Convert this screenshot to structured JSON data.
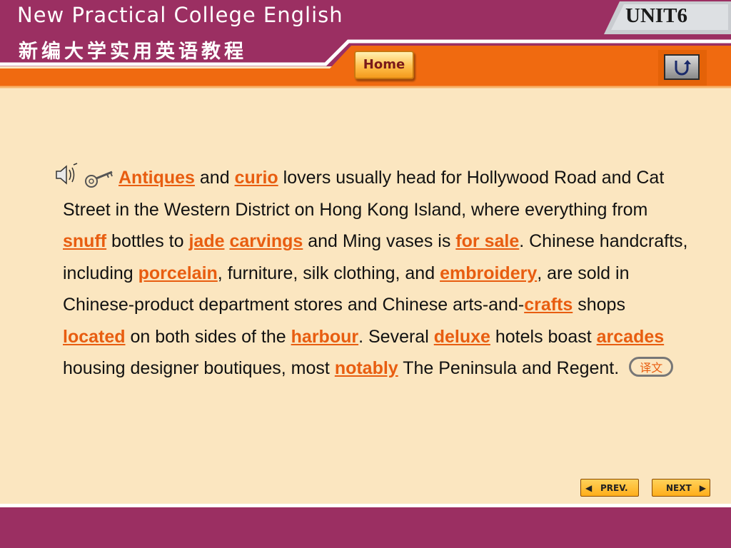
{
  "header": {
    "title_en": "New Practical College English",
    "title_cn": "新编大学实用英语教程",
    "unit_label": "UNIT6",
    "home_label": "Home"
  },
  "icons": {
    "speaker": "speaker-icon",
    "key": "key-icon",
    "return": "return-icon"
  },
  "passage": [
    {
      "t": "Antiques",
      "v": true
    },
    {
      "t": " and "
    },
    {
      "t": "curio",
      "v": true
    },
    {
      "t": " lovers usually head for Hollywood Road and Cat Street in the Western District on Hong Kong Island, where everything from "
    },
    {
      "t": "snuff",
      "v": true
    },
    {
      "t": " bottles to "
    },
    {
      "t": "jade",
      "v": true
    },
    {
      "t": " "
    },
    {
      "t": "carvings",
      "v": true
    },
    {
      "t": " and Ming vases is "
    },
    {
      "t": "for sale",
      "v": true
    },
    {
      "t": ". Chinese handcrafts, including "
    },
    {
      "t": "porcelain",
      "v": true
    },
    {
      "t": ", furniture, silk clothing, and "
    },
    {
      "t": "embroidery",
      "v": true
    },
    {
      "t": ", are sold in Chinese-product department stores and Chinese arts-and-"
    },
    {
      "t": "crafts",
      "v": true
    },
    {
      "t": " shops "
    },
    {
      "t": "located",
      "v": true
    },
    {
      "t": " on both sides of the "
    },
    {
      "t": "harbour",
      "v": true
    },
    {
      "t": ". Several "
    },
    {
      "t": "deluxe",
      "v": true
    },
    {
      "t": " hotels boast "
    },
    {
      "t": "arcades",
      "v": true
    },
    {
      "t": " housing designer boutiques, most "
    },
    {
      "t": "notably",
      "v": true
    },
    {
      "t": " The Peninsula and Regent."
    }
  ],
  "translate_label": "译文",
  "nav": {
    "prev_label": "PREV.",
    "next_label": "NEXT"
  },
  "colors": {
    "header": "#9b2f62",
    "accent_orange": "#f06a10",
    "vocab": "#e85d10",
    "background": "#fbe6c0"
  }
}
